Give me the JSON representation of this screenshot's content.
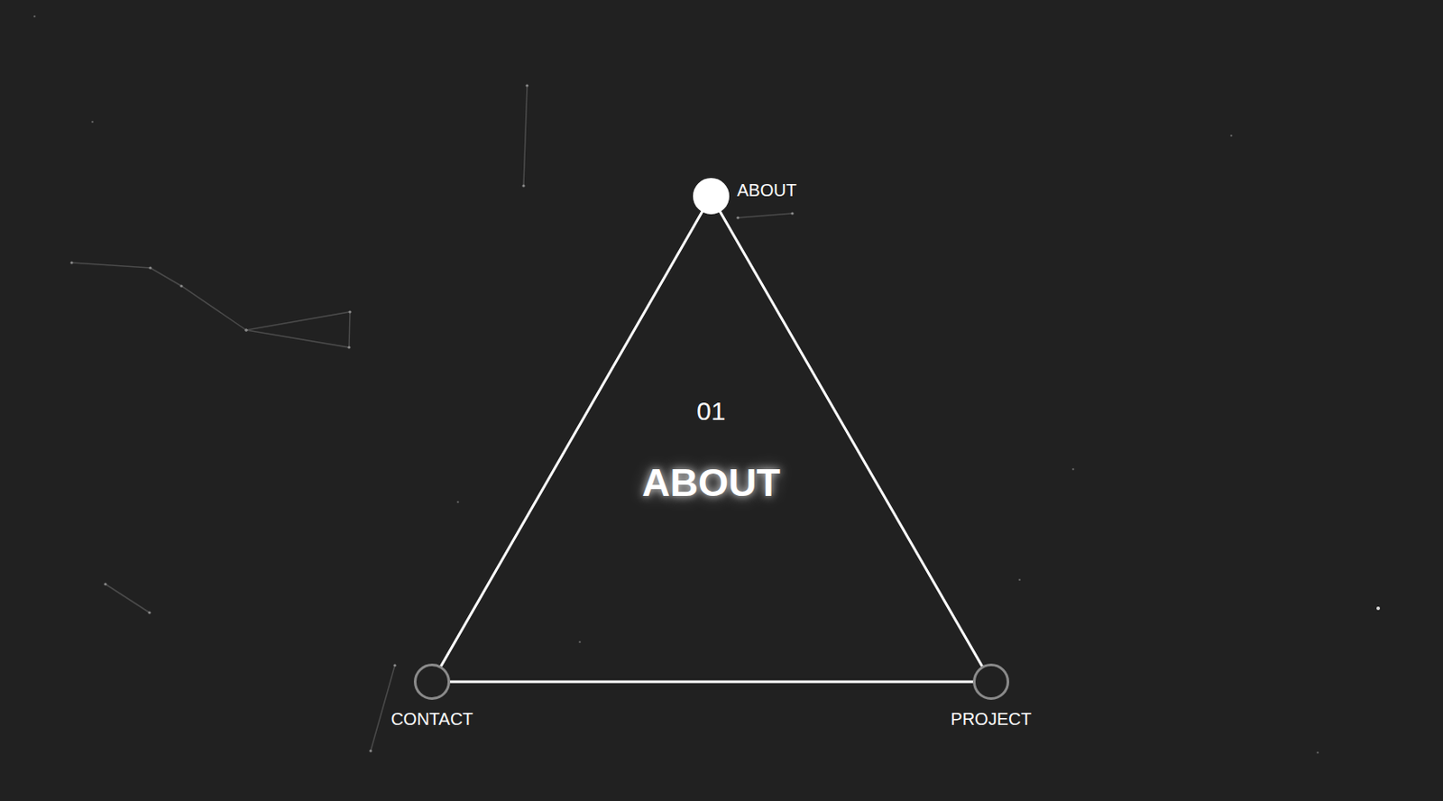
{
  "nodes": [
    {
      "label": "ABOUT",
      "selected": true
    },
    {
      "label": "CONTACT",
      "selected": false
    },
    {
      "label": "PROJECT",
      "selected": false
    }
  ],
  "current": {
    "number": "01",
    "title": "ABOUT"
  }
}
